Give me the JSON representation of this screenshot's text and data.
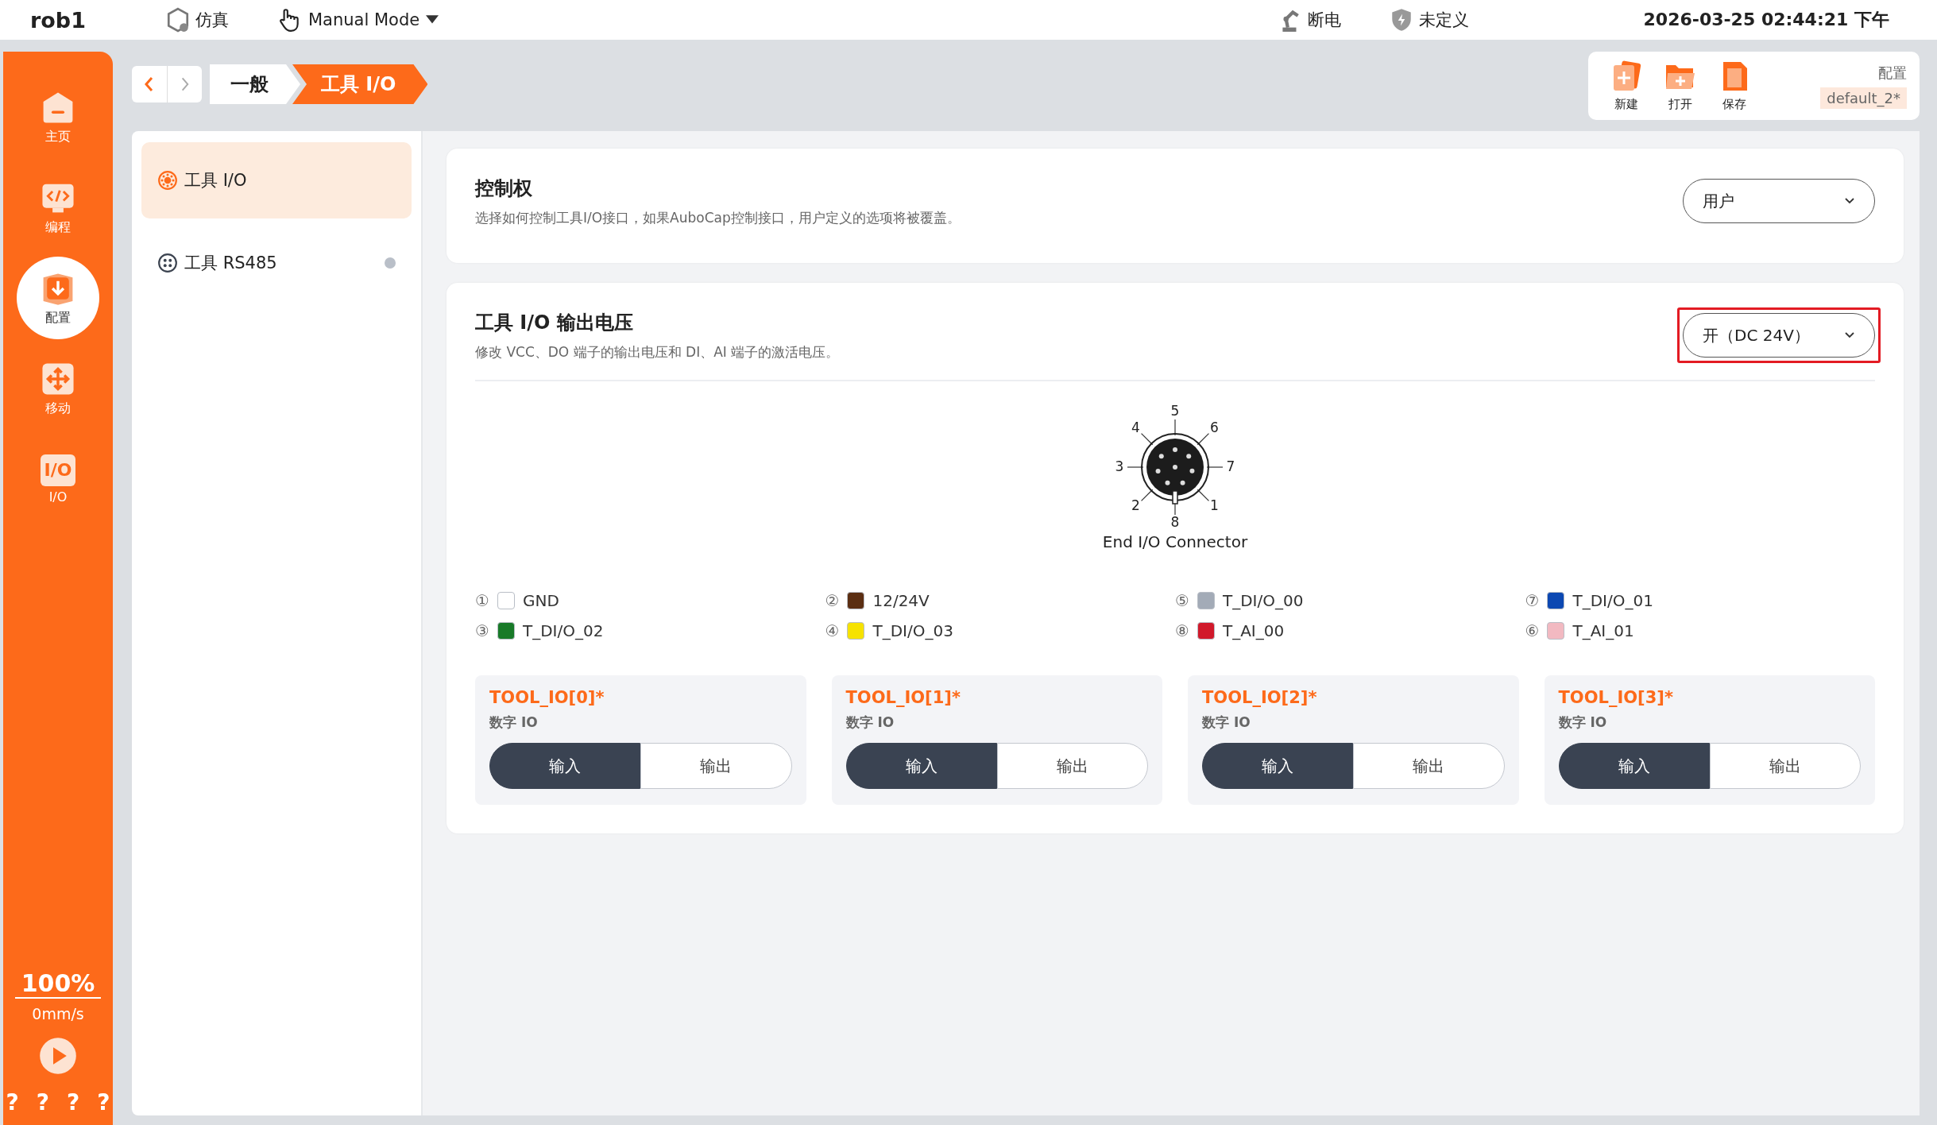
{
  "top_bar": {
    "robot": "rob1",
    "sim": "仿真",
    "mode": "Manual Mode",
    "power": "断电",
    "safety": "未定义",
    "datetime": "2026-03-25 02:44:21 下午"
  },
  "nav": [
    {
      "label": "主页",
      "kind": "home",
      "selected": false
    },
    {
      "label": "编程",
      "kind": "code",
      "selected": false
    },
    {
      "label": "配置",
      "kind": "config",
      "selected": true
    },
    {
      "label": "移动",
      "kind": "move",
      "selected": false
    },
    {
      "label": "I/O",
      "kind": "io",
      "icon_text": "I/O",
      "selected": false
    }
  ],
  "speed": {
    "percent": "100%",
    "rate": "0mm/s",
    "help": [
      "?",
      "?",
      "?",
      "?"
    ]
  },
  "breadcrumb": [
    {
      "label": "一般",
      "selected": false
    },
    {
      "label": "工具 I/O",
      "selected": true
    }
  ],
  "toolbar": {
    "buttons": [
      {
        "label": "新建",
        "kind": "new"
      },
      {
        "label": "打开",
        "kind": "open"
      },
      {
        "label": "保存",
        "kind": "save"
      }
    ],
    "config_label": "配置",
    "config_value": "default_2*"
  },
  "sidebar": {
    "items": [
      {
        "label": "工具 I/O",
        "kind": "io",
        "selected": true,
        "status_dot": false
      },
      {
        "label": "工具 RS485",
        "kind": "rs485",
        "selected": false,
        "status_dot": true
      }
    ]
  },
  "sections": [
    {
      "title": "控制权",
      "description": "选择如何控制工具I/O接口，如果AuboCap控制接口，用户定义的选项将被覆盖。",
      "dropdown": {
        "value": "用户",
        "highlighted": false
      }
    },
    {
      "title": "工具 I/O 输出电压",
      "description": "修改 VCC、DO 端子的输出电压和 DI、AI 端子的激活电压。",
      "dropdown": {
        "value": "开（DC 24V）",
        "highlighted": true
      }
    }
  ],
  "connector": {
    "pins": [
      "5",
      "6",
      "7",
      "1",
      "8",
      "2",
      "3",
      "4"
    ],
    "caption": "End I/O Connector"
  },
  "legend": [
    {
      "index": "①",
      "label": "GND",
      "color": "#ffffff"
    },
    {
      "index": "②",
      "label": "12/24V",
      "color": "#5b2e12"
    },
    {
      "index": "⑤",
      "label": "T_DI/O_00",
      "color": "#a3abb7"
    },
    {
      "index": "⑦",
      "label": "T_DI/O_01",
      "color": "#0c48b2"
    },
    {
      "index": "③",
      "label": "T_DI/O_02",
      "color": "#187a28"
    },
    {
      "index": "④",
      "label": "T_DI/O_03",
      "color": "#f6e200"
    },
    {
      "index": "⑧",
      "label": "T_AI_00",
      "color": "#d1192b"
    },
    {
      "index": "⑥",
      "label": "T_AI_01",
      "color": "#f2b9c1"
    }
  ],
  "io_cards": [
    {
      "title": "TOOL_IO[0]*",
      "type": "数字 IO",
      "options": [
        {
          "label": "输入",
          "selected": true
        },
        {
          "label": "输出",
          "selected": false
        }
      ]
    },
    {
      "title": "TOOL_IO[1]*",
      "type": "数字 IO",
      "options": [
        {
          "label": "输入",
          "selected": true
        },
        {
          "label": "输出",
          "selected": false
        }
      ]
    },
    {
      "title": "TOOL_IO[2]*",
      "type": "数字 IO",
      "options": [
        {
          "label": "输入",
          "selected": true
        },
        {
          "label": "输出",
          "selected": false
        }
      ]
    },
    {
      "title": "TOOL_IO[3]*",
      "type": "数字 IO",
      "options": [
        {
          "label": "输入",
          "selected": true
        },
        {
          "label": "输出",
          "selected": false
        }
      ]
    }
  ]
}
